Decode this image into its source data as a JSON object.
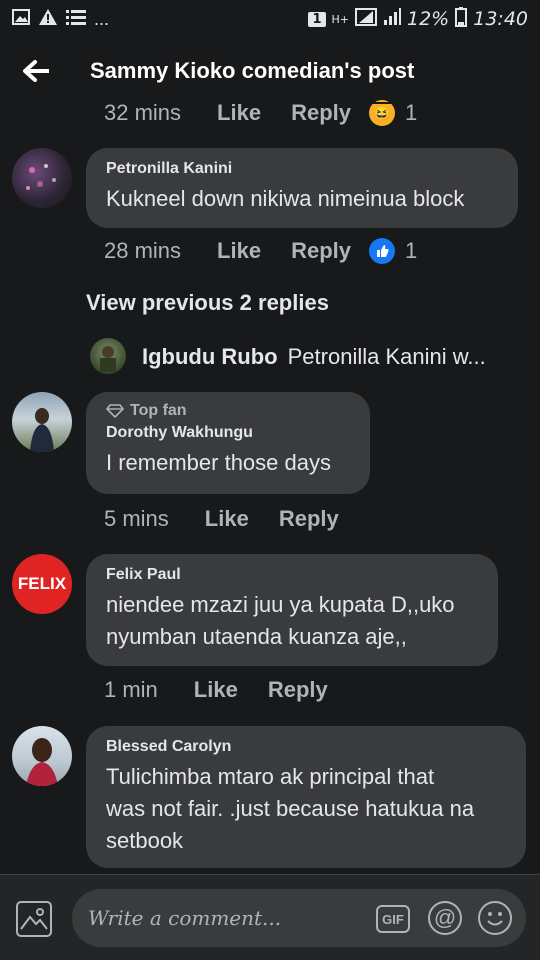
{
  "status_bar": {
    "left_icons": [
      "image-icon",
      "warning-icon",
      "list-icon"
    ],
    "more": "...",
    "sim": "1",
    "network": "H+",
    "battery_pct": "12%",
    "time": "13:40"
  },
  "header": {
    "title": "Sammy Kioko comedian's post"
  },
  "comments": [
    {
      "time": "32 mins",
      "like": "Like",
      "reply": "Reply",
      "reaction": "1"
    },
    {
      "name": "Petronilla Kanini",
      "text": "Kukneel down nikiwa nimeinua block",
      "time": "28 mins",
      "like": "Like",
      "reply": "Reply",
      "reaction": "1"
    },
    {
      "view_previous": "View previous 2 replies",
      "reply_name": "Igbudu Rubo",
      "reply_preview": "Petronilla Kanini w..."
    },
    {
      "badge": "Top fan",
      "name": "Dorothy Wakhungu",
      "text": "I remember those days",
      "time": "5 mins",
      "like": "Like",
      "reply": "Reply"
    },
    {
      "avatar_label": "FELIX",
      "name": "Felix Paul",
      "text_line1": "niendee mzazi juu ya kupata D,,uko",
      "text_line2": "nyumban utaenda kuanza aje,,",
      "time": "1 min",
      "like": "Like",
      "reply": "Reply"
    },
    {
      "name": "Blessed Carolyn",
      "text_line1": "Tulichimba mtaro ak principal that",
      "text_line2": "was not fair. .just because hatukua na",
      "text_line3": "setbook"
    }
  ],
  "composer": {
    "placeholder": "Write a comment...",
    "gif_label": "GIF",
    "at_label": "@"
  },
  "colors": {
    "background": "#18191a",
    "bubble": "#3a3b3c",
    "like_blue": "#1877f2",
    "felix_red": "#e02424"
  }
}
